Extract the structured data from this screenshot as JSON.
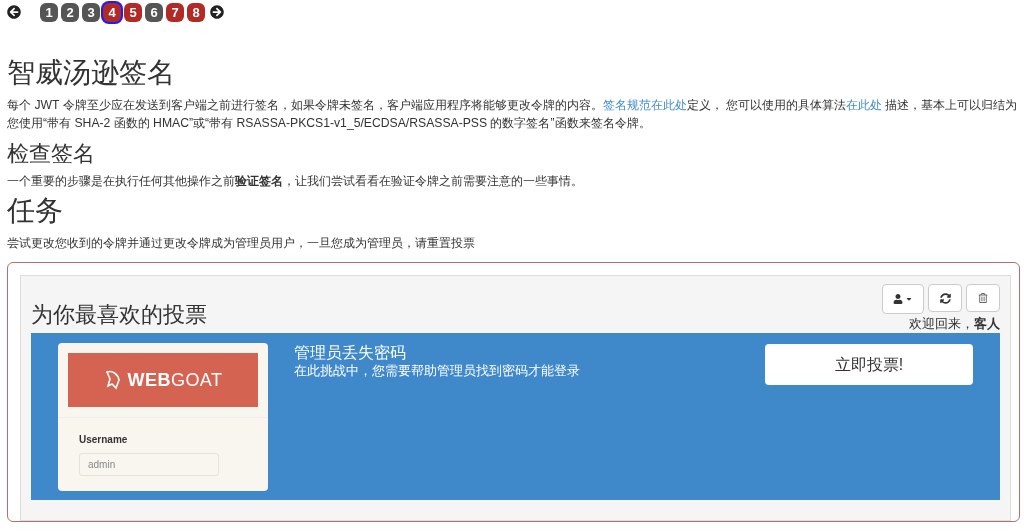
{
  "pager": {
    "pages": [
      {
        "label": "1",
        "selected": false,
        "has_assignment": false
      },
      {
        "label": "2",
        "selected": false,
        "has_assignment": false
      },
      {
        "label": "3",
        "selected": false,
        "has_assignment": false
      },
      {
        "label": "4",
        "selected": true,
        "has_assignment": true
      },
      {
        "label": "5",
        "selected": false,
        "has_assignment": true
      },
      {
        "label": "6",
        "selected": false,
        "has_assignment": false
      },
      {
        "label": "7",
        "selected": false,
        "has_assignment": true
      },
      {
        "label": "8",
        "selected": false,
        "has_assignment": true
      }
    ]
  },
  "sections": [
    {
      "heading": "智威汤逊签名",
      "kind": "title",
      "paragraph": [
        {
          "text": "每个 JWT 令牌至少应在发送到客户端之前进行签名，如果令牌未签名，客户端应用程序将能够更改令牌的内容。"
        },
        {
          "text": "签名规范在此处",
          "link": true
        },
        {
          "text": "定义， 您可以使用的具体算法"
        },
        {
          "text": "在此处",
          "link": true
        },
        {
          "text": " 描述，基本上可以归结为您使用“带有 SHA-2 函数的 HMAC”或“带有 RSASSA-PKCS1-v1_5/ECDSA/RSASSA-PSS 的数字签名”函数来签名令牌。"
        }
      ]
    },
    {
      "heading": "检查签名",
      "kind": "subtitle",
      "paragraph": [
        {
          "text": "一个重要的步骤是在执行任何其他操作之前**验证签名**，让我们尝试看看在验证令牌之前需要注意的一些事情。"
        }
      ]
    },
    {
      "heading": "任务",
      "kind": "title",
      "paragraph": [
        {
          "text": "尝试更改您收到的令牌并通过更改令牌成为管理员用户，一旦您成为管理员，请重置投票"
        }
      ]
    }
  ],
  "voting": {
    "title": "为你最喜欢的投票",
    "welcome": "欢迎回来，",
    "user": "客人",
    "card": {
      "title": "管理员丢失密码",
      "description": "在此挑战中，您需要帮助管理员找到密码才能登录",
      "button": "立即投票!",
      "preview": {
        "logo_bold": "WEB",
        "logo_light": "GOAT",
        "field_label": "Username",
        "placeholder": "admin"
      }
    }
  }
}
